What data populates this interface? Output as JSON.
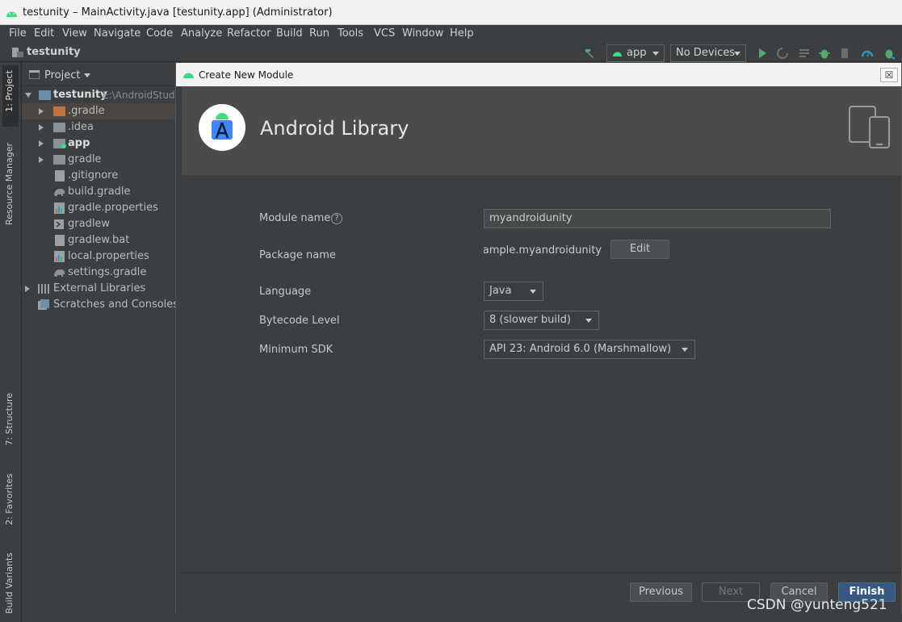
{
  "window": {
    "title": "testunity – MainActivity.java [testunity.app] (Administrator)"
  },
  "menu": [
    "File",
    "Edit",
    "View",
    "Navigate",
    "Code",
    "Analyze",
    "Refactor",
    "Build",
    "Run",
    "Tools",
    "VCS",
    "Window",
    "Help"
  ],
  "navbar": {
    "project": "testunity",
    "run_config": "app",
    "device": "No Devices"
  },
  "left_tabs": {
    "project": "1: Project",
    "resource_manager": "Resource Manager",
    "structure": "7: Structure",
    "favorites": "2: Favorites",
    "build_variants": "Build Variants"
  },
  "project_panel": {
    "view_label": "Project",
    "root": {
      "label": "testunity",
      "path": "E:\\AndroidStud"
    },
    "items": [
      {
        "label": ".gradle"
      },
      {
        "label": ".idea"
      },
      {
        "label": "app"
      },
      {
        "label": "gradle"
      },
      {
        "label": ".gitignore"
      },
      {
        "label": "build.gradle"
      },
      {
        "label": "gradle.properties"
      },
      {
        "label": "gradlew"
      },
      {
        "label": "gradlew.bat"
      },
      {
        "label": "local.properties"
      },
      {
        "label": "settings.gradle"
      },
      {
        "label": "External Libraries"
      },
      {
        "label": "Scratches and Consoles"
      }
    ]
  },
  "dialog": {
    "title": "Create New Module",
    "close": "☒",
    "heading": "Android Library",
    "module_name_label": "Module name",
    "module_name_value": "myandroidunity",
    "package_name_label": "Package name",
    "package_name_value": "xample.myandroidunity",
    "edit_button": "Edit",
    "language_label": "Language",
    "language_value": "Java",
    "bytecode_label": "Bytecode Level",
    "bytecode_value": "8 (slower build)",
    "min_sdk_label": "Minimum SDK",
    "min_sdk_value": "API 23: Android 6.0 (Marshmallow)",
    "buttons": {
      "previous": "Previous",
      "next": "Next",
      "cancel": "Cancel",
      "finish": "Finish"
    }
  },
  "watermark": "CSDN @yunteng521",
  "colors": {
    "accent": "#365880",
    "android_green": "#3ddc84",
    "run_green": "#59a869"
  }
}
